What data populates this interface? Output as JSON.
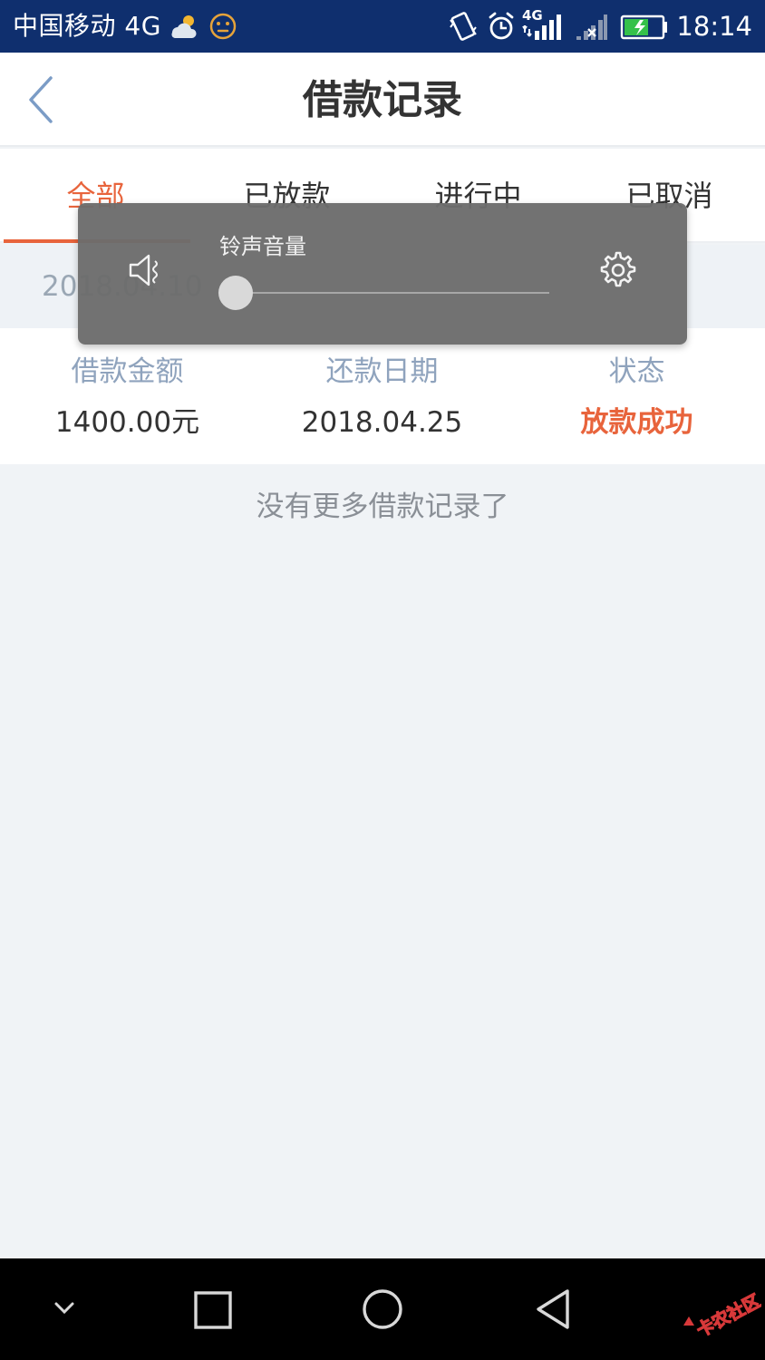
{
  "status_bar": {
    "carrier": "中国移动 4G",
    "network_label": "4G",
    "time": "18:14"
  },
  "header": {
    "title": "借款记录"
  },
  "tabs": [
    {
      "label": "全部",
      "active": true
    },
    {
      "label": "已放款",
      "active": false
    },
    {
      "label": "进行中",
      "active": false
    },
    {
      "label": "已取消",
      "active": false
    }
  ],
  "record": {
    "date": "2018.04.10",
    "amount_label": "借款金额",
    "amount_value": "1400.00元",
    "due_label": "还款日期",
    "due_value": "2018.04.25",
    "status_label": "状态",
    "status_value": "放款成功"
  },
  "footer_text": "没有更多借款记录了",
  "volume": {
    "label": "铃声音量",
    "level": 0
  },
  "watermark": "卡农社区",
  "colors": {
    "status_bar": "#0f2f6e",
    "accent": "#e8643c",
    "label_blue": "#8fa3bd",
    "page_bg": "#f0f3f6"
  },
  "icons": [
    "weather-cloud-icon",
    "face-icon",
    "vibrate-icon",
    "alarm-icon",
    "signal-icon",
    "signal-x-icon",
    "battery-icon",
    "back-icon",
    "speaker-icon",
    "settings-icon",
    "nav-down-icon",
    "nav-recent-icon",
    "nav-home-icon",
    "nav-back-icon"
  ]
}
